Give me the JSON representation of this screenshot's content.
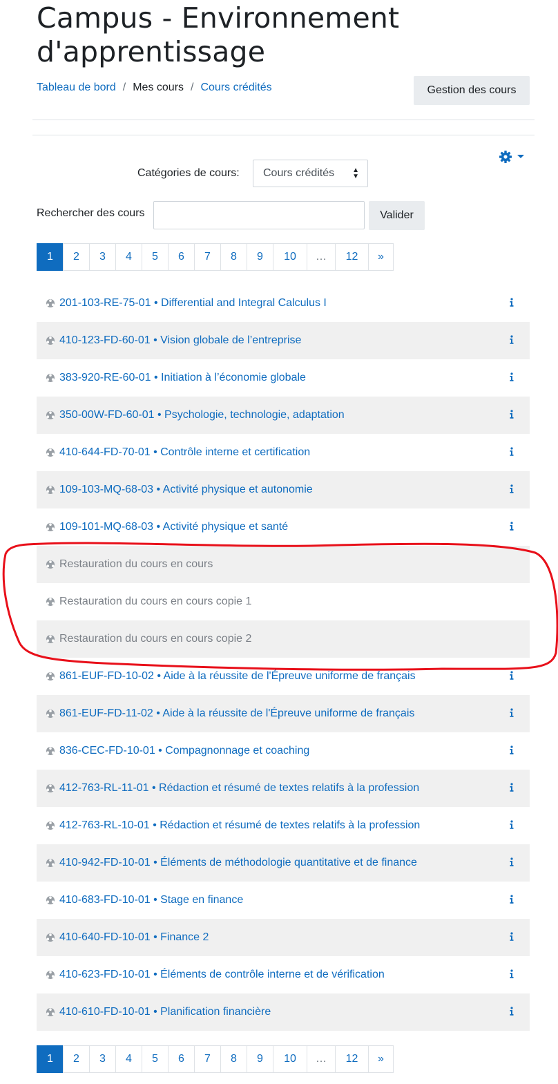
{
  "page": {
    "title": "Campus - Environnement d'apprentissage",
    "manage_button": "Gestion des cours"
  },
  "breadcrumb": {
    "items": [
      "Tableau de bord",
      "Mes cours",
      "Cours crédités"
    ],
    "separator": "/"
  },
  "filters": {
    "category_label": "Catégories de cours:",
    "category_value": "Cours crédités",
    "search_label": "Rechercher des cours",
    "search_value": "",
    "search_button": "Valider"
  },
  "pagination": {
    "pages": [
      "1",
      "2",
      "3",
      "4",
      "5",
      "6",
      "7",
      "8",
      "9",
      "10",
      "…",
      "12",
      "»"
    ],
    "active": "1"
  },
  "courses": [
    {
      "name": "201-103-RE-75-01 • Differential and Integral Calculus I",
      "info": true,
      "dimmed": false
    },
    {
      "name": "410-123-FD-60-01 • Vision globale de l’entreprise",
      "info": true,
      "dimmed": false
    },
    {
      "name": "383-920-RE-60-01 • Initiation à l’économie globale",
      "info": true,
      "dimmed": false
    },
    {
      "name": "350-00W-FD-60-01 • Psychologie, technologie, adaptation",
      "info": true,
      "dimmed": false
    },
    {
      "name": "410-644-FD-70-01 • Contrôle interne et certification",
      "info": true,
      "dimmed": false
    },
    {
      "name": "109-103-MQ-68-03 • Activité physique et autonomie",
      "info": true,
      "dimmed": false
    },
    {
      "name": "109-101-MQ-68-03 • Activité physique et santé",
      "info": true,
      "dimmed": false
    },
    {
      "name": "Restauration du cours en cours",
      "info": false,
      "dimmed": true
    },
    {
      "name": "Restauration du cours en cours copie 1",
      "info": false,
      "dimmed": true
    },
    {
      "name": "Restauration du cours en cours copie 2",
      "info": false,
      "dimmed": true
    },
    {
      "name": "861-EUF-FD-10-02 • Aide à la réussite de l'Épreuve uniforme de français",
      "info": true,
      "dimmed": false
    },
    {
      "name": "861-EUF-FD-11-02 • Aide à la réussite de l'Épreuve uniforme de français",
      "info": true,
      "dimmed": false
    },
    {
      "name": "836-CEC-FD-10-01 • Compagnonnage et coaching",
      "info": true,
      "dimmed": false
    },
    {
      "name": "412-763-RL-11-01 • Rédaction et résumé de textes relatifs à la profession",
      "info": true,
      "dimmed": false
    },
    {
      "name": "412-763-RL-10-01 • Rédaction et résumé de textes relatifs à la profession",
      "info": true,
      "dimmed": false
    },
    {
      "name": "410-942-FD-10-01 • Éléments de méthodologie quantitative et de finance",
      "info": true,
      "dimmed": false
    },
    {
      "name": "410-683-FD-10-01 • Stage en finance",
      "info": true,
      "dimmed": false
    },
    {
      "name": "410-640-FD-10-01 • Finance 2",
      "info": true,
      "dimmed": false
    },
    {
      "name": "410-623-FD-10-01 • Éléments de contrôle interne et de vérification",
      "info": true,
      "dimmed": false
    },
    {
      "name": "410-610-FD-10-01 • Planification financière",
      "info": true,
      "dimmed": false
    }
  ],
  "colors": {
    "link": "#0f6cbf",
    "annotation": "#e8101a",
    "row_stripe": "#f0f0f0"
  }
}
